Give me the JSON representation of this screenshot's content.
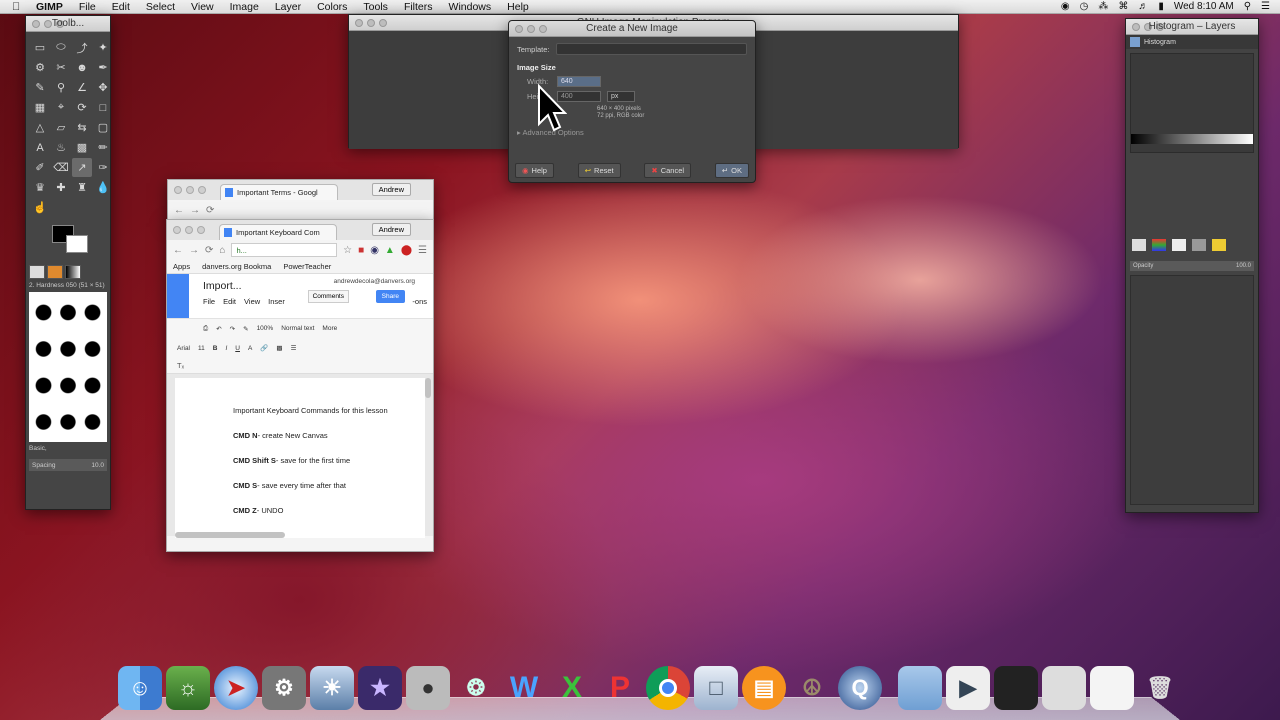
{
  "menubar": {
    "app_name": "GIMP",
    "items": [
      "File",
      "Edit",
      "Select",
      "View",
      "Image",
      "Layer",
      "Colors",
      "Tools",
      "Filters",
      "Windows",
      "Help"
    ],
    "clock": "Wed 8:10 AM"
  },
  "toolbox": {
    "title": "Toolb...",
    "brush_label": "2. Hardness 050 (51 × 51)",
    "brush_category": "Basic,",
    "spacing_label": "Spacing",
    "spacing_value": "10.0"
  },
  "gimp_main": {
    "title": "GNU Image Manipulation Program"
  },
  "new_image_dialog": {
    "title": "Create a New Image",
    "template_label": "Template:",
    "section_title": "Image Size",
    "width_label": "Width:",
    "width_value": "640",
    "height_label": "Height:",
    "height_value": "400",
    "unit": "px",
    "info_line1": "640 × 400 pixels",
    "info_line2": "72 ppi, RGB color",
    "advanced_label": "Advanced Options",
    "buttons": {
      "help": "Help",
      "reset": "Reset",
      "cancel": "Cancel",
      "ok": "OK"
    }
  },
  "chrome_back": {
    "tab_title": "Important Terms - Googl",
    "user": "Andrew"
  },
  "chrome_front": {
    "tab_title": "Important Keyboard Com",
    "user": "Andrew",
    "omnibox": "h...",
    "bookmarks": [
      "Apps",
      "danvers.org Bookma",
      "PowerTeacher"
    ],
    "doc": {
      "title": "Import...",
      "email": "andrewdecola@danvers.org",
      "comments_label": "Comments",
      "share_label": "Share",
      "menu": [
        "File",
        "Edit",
        "View",
        "Inser"
      ],
      "menu_tail": "-ons",
      "zoom": "100%",
      "style": "Normal text",
      "more": "More",
      "font": "Arial",
      "font_size": "11",
      "lines": [
        {
          "bold": "",
          "text": "Important Keyboard Commands for this lesson"
        },
        {
          "bold": "CMD N",
          "text": "- create New Canvas"
        },
        {
          "bold": "CMD Shift S",
          "text": "- save for the first time"
        },
        {
          "bold": "CMD S",
          "text": "-  save every time after that"
        },
        {
          "bold": "CMD Z",
          "text": "- UNDO"
        }
      ]
    }
  },
  "dock_panel": {
    "title": "Histogram – Layers",
    "tab_label": "Histogram",
    "opacity_label": "Opacity",
    "opacity_value": "100.0"
  },
  "dock": {
    "apps": [
      "Finder",
      "Photo Booth",
      "Safari",
      "System Preferences",
      "iPhoto",
      "iMovie",
      "DVD Player",
      "Chrome Remote",
      "Word",
      "Excel",
      "PowerPoint",
      "Google Chrome",
      "Preview",
      "iBooks",
      "GIMP",
      "QuickTime",
      "Folder",
      "MPEG4",
      "Screen",
      "Window",
      "Chrome Window",
      "Trash"
    ]
  }
}
